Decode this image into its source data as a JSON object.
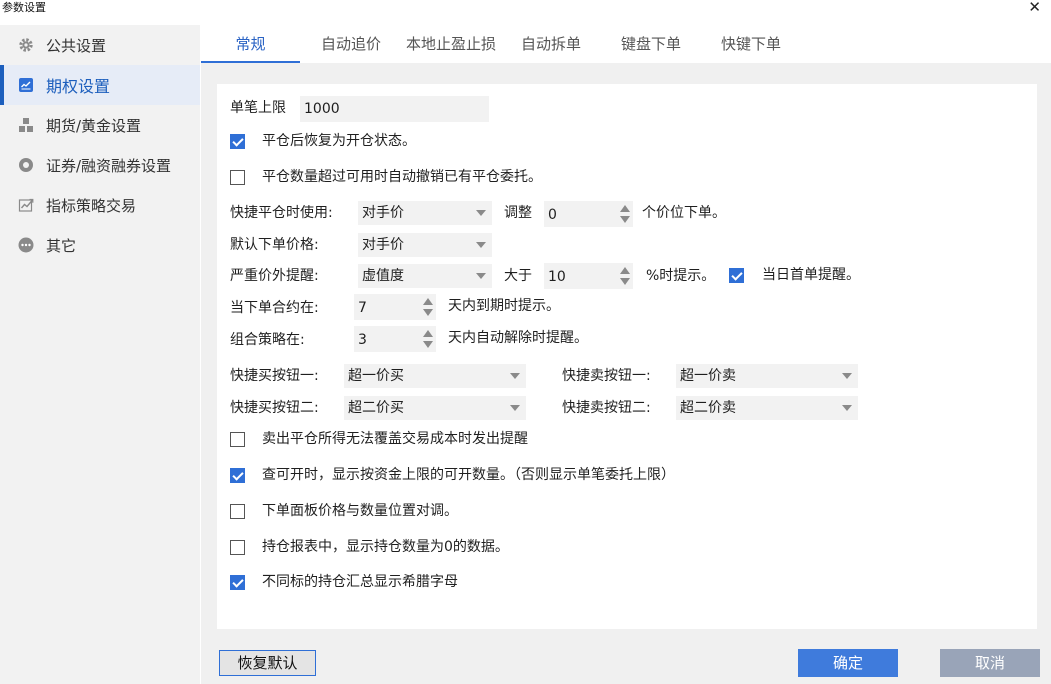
{
  "window": {
    "title": "参数设置",
    "close_glyph": "✕"
  },
  "sidebar": {
    "items": [
      {
        "label": "公共设置",
        "icon": "gear-icon"
      },
      {
        "label": "期权设置",
        "icon": "option-chart-icon",
        "active": true
      },
      {
        "label": "期货/黄金设置",
        "icon": "futures-blocks-icon"
      },
      {
        "label": "证券/融资融券设置",
        "icon": "securities-circle-icon"
      },
      {
        "label": "指标策略交易",
        "icon": "trend-chart-icon"
      },
      {
        "label": "其它",
        "icon": "more-dots-icon"
      }
    ]
  },
  "tabs": [
    {
      "label": "常规",
      "active": true
    },
    {
      "label": "自动追价"
    },
    {
      "label": "本地止盈止损"
    },
    {
      "label": "自动拆单"
    },
    {
      "label": "键盘下单"
    },
    {
      "label": "快键下单"
    }
  ],
  "form": {
    "single_limit": {
      "label": "单笔上限",
      "value": "1000"
    },
    "restore_open_state": {
      "label": "平仓后恢复为开仓状态。",
      "checked": true
    },
    "auto_cancel_close": {
      "label": "平仓数量超过可用时自动撤销已有平仓委托。",
      "checked": false
    },
    "quick_close": {
      "label": "快捷平仓时使用:",
      "select": "对手价",
      "adjust_label": "调整",
      "adjust_value": "0",
      "suffix": "个价位下单。"
    },
    "default_price": {
      "label": "默认下单价格:",
      "select": "对手价"
    },
    "severe_alert": {
      "label": "严重价外提醒:",
      "select": "虚值度",
      "gt_label": "大于",
      "gt_value": "10",
      "suffix": "%时提示。",
      "first_order_label": "当日首单提醒。",
      "first_order_checked": true
    },
    "contract_expiry": {
      "label": "当下单合约在:",
      "value": "7",
      "suffix": "天内到期时提示。"
    },
    "combo_strategy": {
      "label": "组合策略在:",
      "value": "3",
      "suffix": "天内自动解除时提醒。"
    },
    "buy_btn1": {
      "label": "快捷买按钮一:",
      "select": "超一价买"
    },
    "sell_btn1": {
      "label": "快捷卖按钮一:",
      "select": "超一价卖"
    },
    "buy_btn2": {
      "label": "快捷买按钮二:",
      "select": "超二价买"
    },
    "sell_btn2": {
      "label": "快捷卖按钮二:",
      "select": "超二价卖"
    },
    "sell_close_alert": {
      "label": "卖出平仓所得无法覆盖交易成本时发出提醒",
      "checked": false
    },
    "show_by_fund": {
      "label": "查可开时，显示按资金上限的可开数量。（否则显示单笔委托上限）",
      "checked": true
    },
    "swap_price_qty": {
      "label": "下单面板价格与数量位置对调。",
      "checked": false
    },
    "show_zero_pos": {
      "label": "持仓报表中，显示持仓数量为0的数据。",
      "checked": false
    },
    "greek_letters": {
      "label": "不同标的持仓汇总显示希腊字母",
      "checked": true
    }
  },
  "buttons": {
    "restore": "恢复默认",
    "ok": "确定",
    "cancel": "取消"
  }
}
